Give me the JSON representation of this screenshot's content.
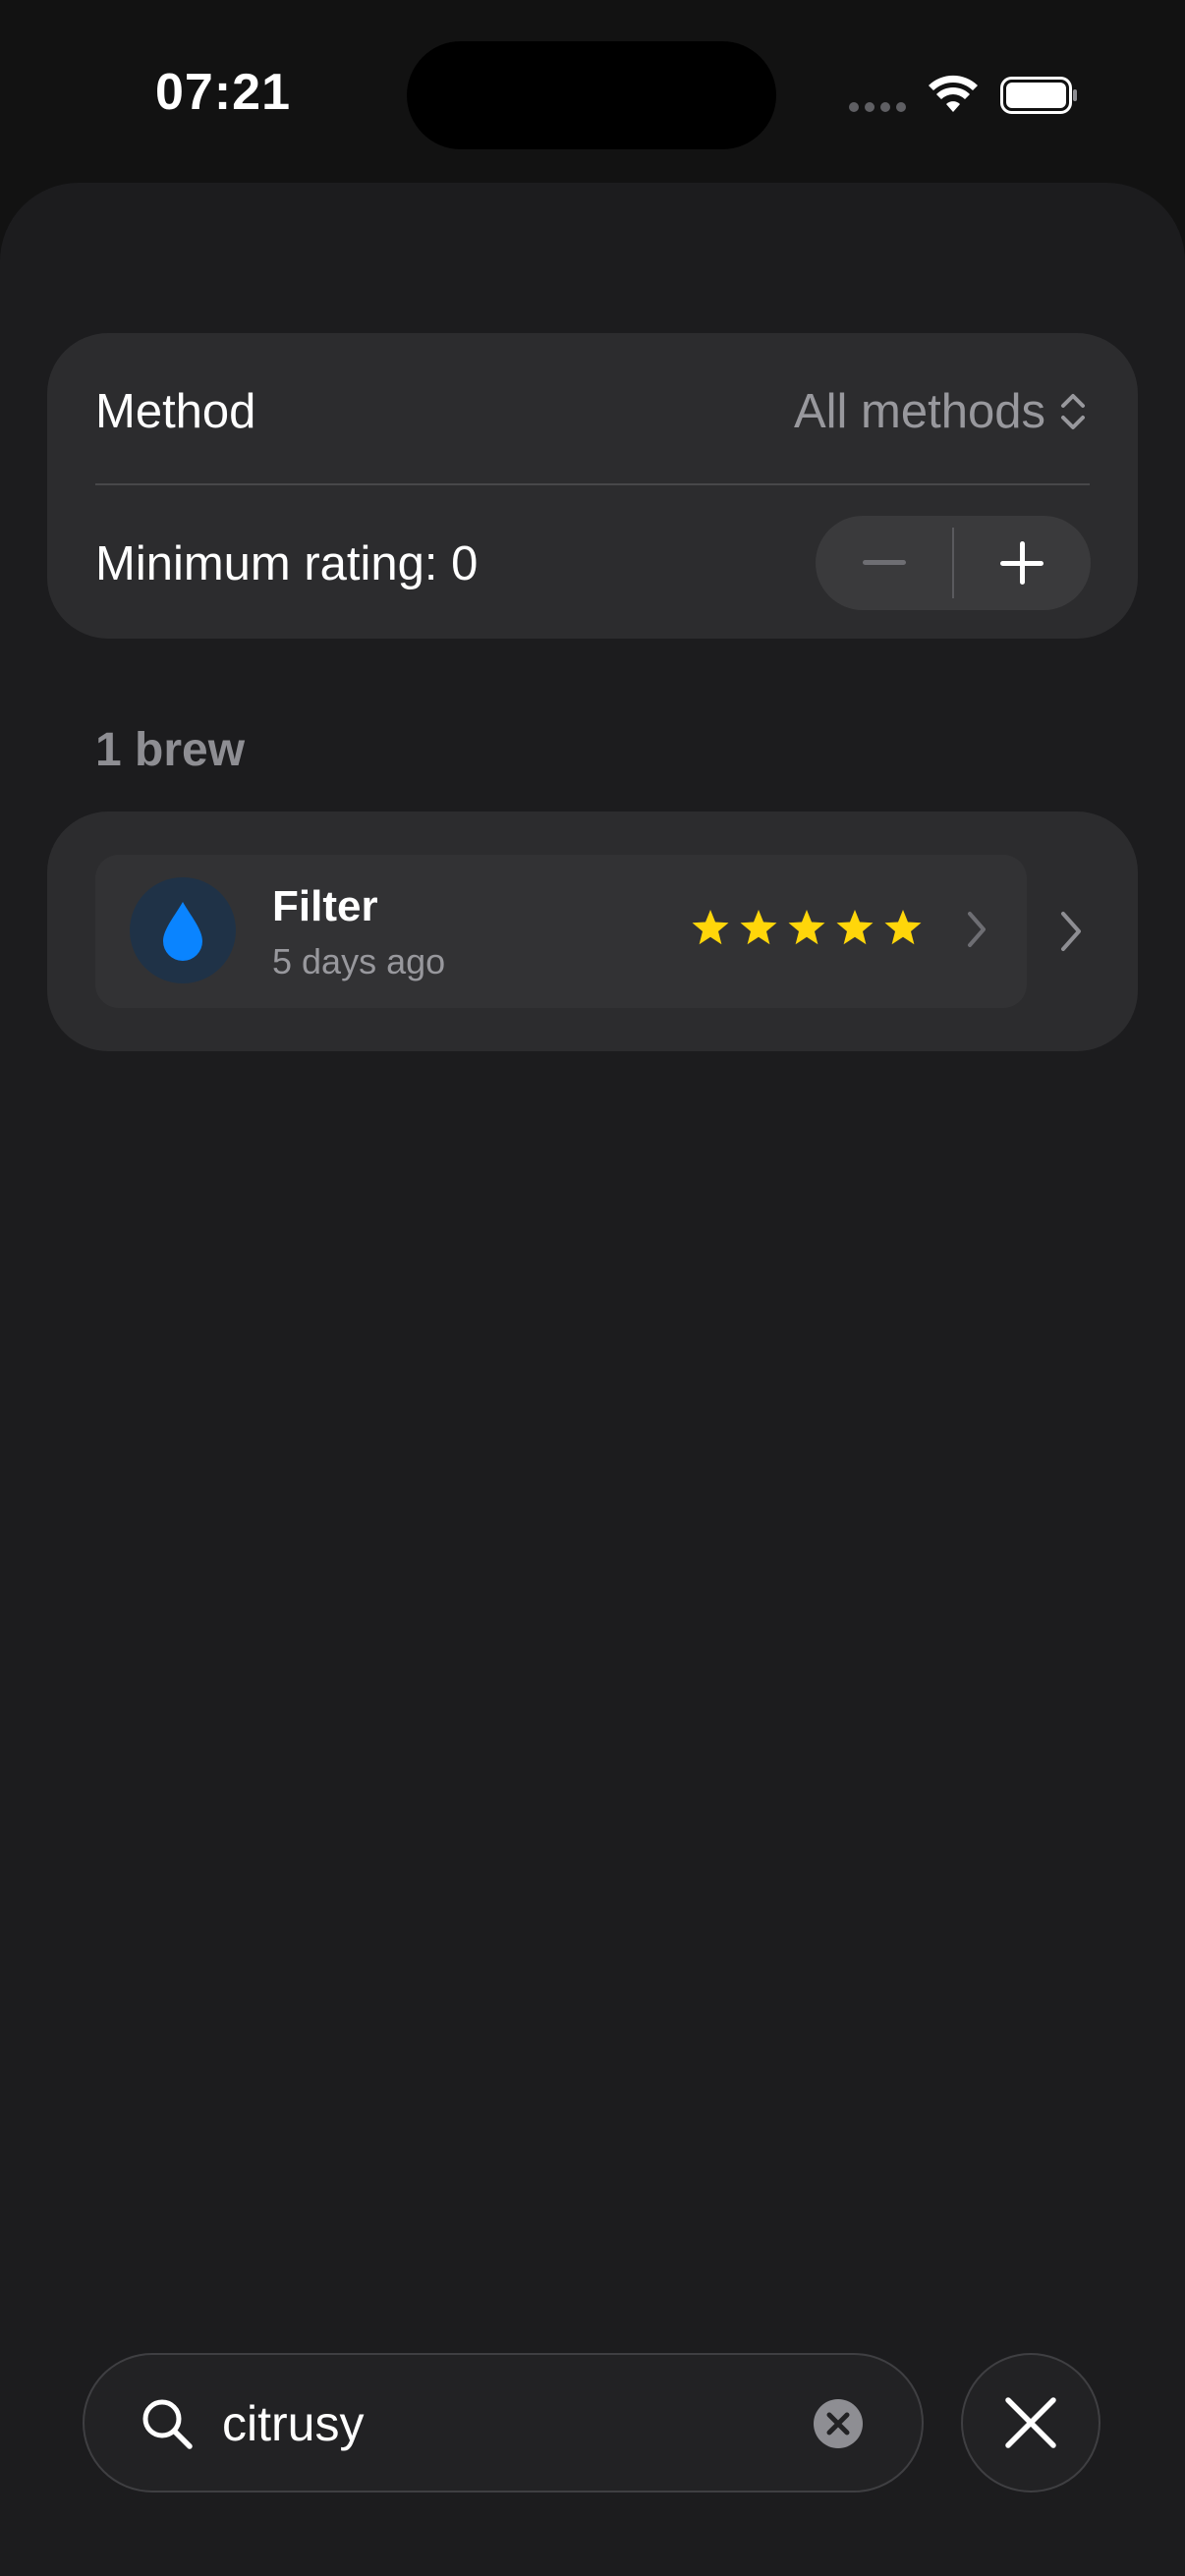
{
  "status_bar": {
    "time": "07:21"
  },
  "filters": {
    "method_label": "Method",
    "method_value": "All methods",
    "rating_label": "Minimum rating: 0"
  },
  "results": {
    "header": "1 brew",
    "items": [
      {
        "title": "Filter",
        "subtitle": "5 days ago",
        "rating": 5,
        "rating_max": 5,
        "icon": "drop-icon"
      }
    ]
  },
  "search": {
    "value": "citrusy"
  },
  "colors": {
    "accent_blue": "#0a84ff",
    "star_yellow": "#ffd60a",
    "card_background": "#2c2c2e",
    "sheet_background": "#1c1c1e"
  }
}
